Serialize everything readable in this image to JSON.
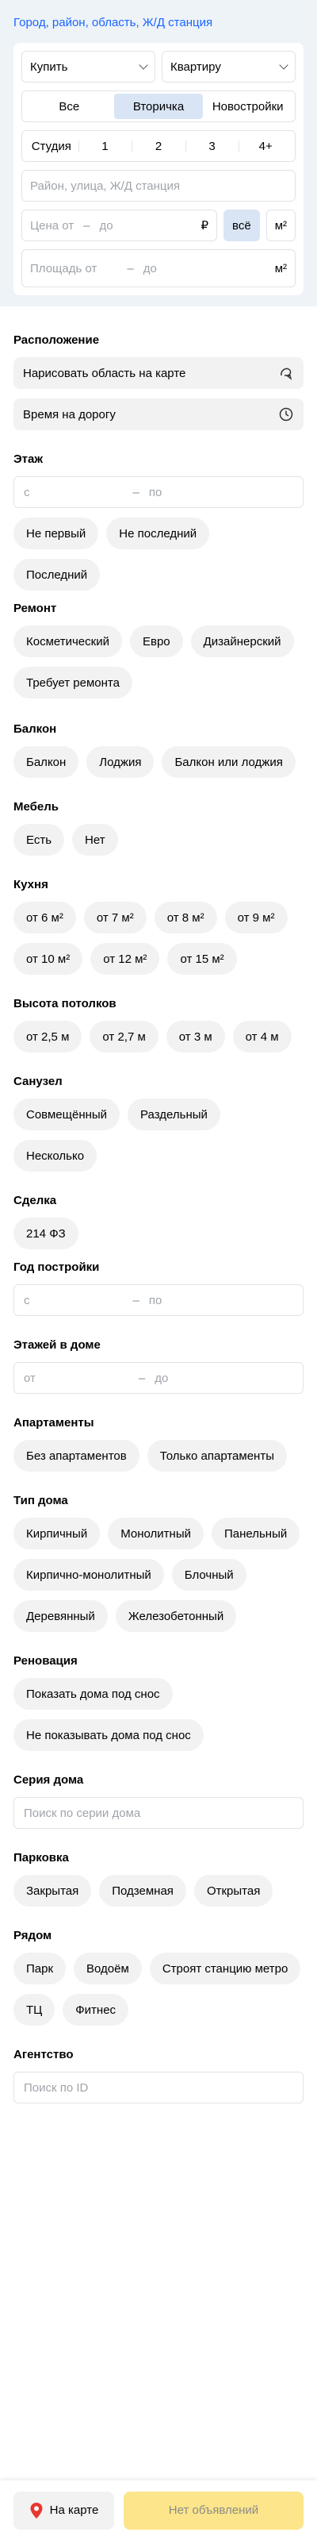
{
  "location_link": "Город, район, область, Ж/Д станция",
  "deal_select": "Купить",
  "object_select": "Квартиру",
  "market_tabs": [
    "Все",
    "Вторичка",
    "Новостройки"
  ],
  "market_active": "Вторичка",
  "rooms": [
    "Студия",
    "1",
    "2",
    "3",
    "4+"
  ],
  "address_placeholder": "Район, улица, Ж/Д станция",
  "price": {
    "from": "Цена от",
    "sep": "–",
    "to": "до",
    "currency": "₽",
    "total": "всё",
    "per_m2": "м²"
  },
  "area": {
    "from": "Площадь от",
    "sep": "–",
    "to": "до",
    "unit": "м²"
  },
  "sections": {
    "location": {
      "title": "Расположение",
      "draw": "Нарисовать область на карте",
      "travel": "Время на дорогу"
    },
    "floor": {
      "title": "Этаж",
      "from": "с",
      "sep": "–",
      "to": "по",
      "options": [
        "Не первый",
        "Не последний",
        "Последний"
      ]
    },
    "renovation": {
      "title": "Ремонт",
      "options": [
        "Косметический",
        "Евро",
        "Дизайнерский",
        "Требует ремонта"
      ]
    },
    "balcony": {
      "title": "Балкон",
      "options": [
        "Балкон",
        "Лоджия",
        "Балкон или лоджия"
      ]
    },
    "furniture": {
      "title": "Мебель",
      "options": [
        "Есть",
        "Нет"
      ]
    },
    "kitchen": {
      "title": "Кухня",
      "options": [
        "от 6 м²",
        "от 7 м²",
        "от 8 м²",
        "от 9 м²",
        "от 10 м²",
        "от 12 м²",
        "от 15 м²"
      ]
    },
    "ceiling": {
      "title": "Высота потолков",
      "options": [
        "от 2,5 м",
        "от 2,7 м",
        "от 3 м",
        "от 4 м"
      ]
    },
    "bathroom": {
      "title": "Санузел",
      "options": [
        "Совмещённый",
        "Раздельный",
        "Несколько"
      ]
    },
    "deal": {
      "title": "Сделка",
      "options": [
        "214 ФЗ"
      ]
    },
    "year": {
      "title": "Год постройки",
      "from": "с",
      "sep": "–",
      "to": "по"
    },
    "floors_total": {
      "title": "Этажей в доме",
      "from": "от",
      "sep": "–",
      "to": "до"
    },
    "apartments": {
      "title": "Апартаменты",
      "options": [
        "Без апартаментов",
        "Только апартаменты"
      ]
    },
    "house_type": {
      "title": "Тип дома",
      "options": [
        "Кирпичный",
        "Монолитный",
        "Панельный",
        "Кирпично-монолитный",
        "Блочный",
        "Деревянный",
        "Железобетонный"
      ]
    },
    "renovation_program": {
      "title": "Реновация",
      "options": [
        "Показать дома под снос",
        "Не показывать дома под снос"
      ]
    },
    "series": {
      "title": "Серия дома",
      "placeholder": "Поиск по серии дома"
    },
    "parking": {
      "title": "Парковка",
      "options": [
        "Закрытая",
        "Подземная",
        "Открытая"
      ]
    },
    "nearby": {
      "title": "Рядом",
      "options": [
        "Парк",
        "Водоём",
        "Строят станцию метро",
        "ТЦ",
        "Фитнес"
      ]
    },
    "agency": {
      "title": "Агентство",
      "placeholder": "Поиск по ID"
    }
  },
  "bottom": {
    "map_label": "На карте",
    "submit_label": "Нет объявлений"
  },
  "colors": {
    "link": "#1a66ff",
    "active_bg": "#d9e5f5",
    "chip_bg": "#f2f2f3",
    "submit_bg": "#fce58a",
    "pin": "#e8382e"
  }
}
